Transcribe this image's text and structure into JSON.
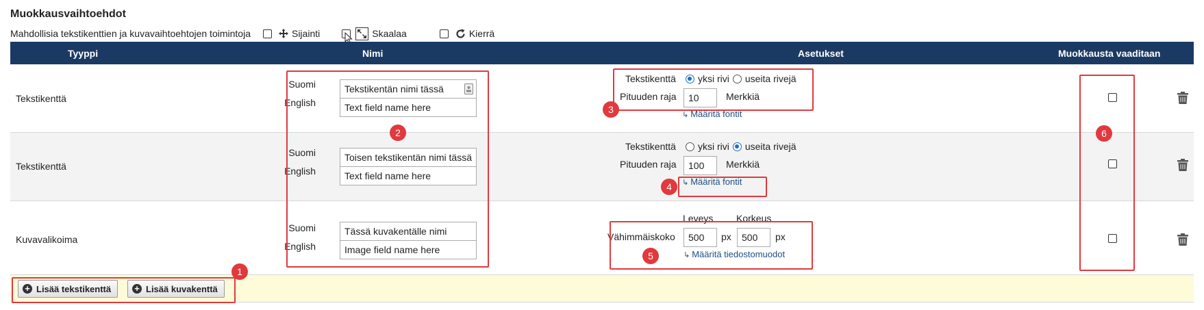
{
  "header": {
    "title": "Muokkausvaihtoehdot",
    "subtitle": "Mahdollisia tekstikenttien ja kuvavaihtoehtojen toimintoja",
    "options": [
      {
        "label": "Sijainti",
        "icon": "move-icon"
      },
      {
        "label": "Skaalaa",
        "icon": "scale-icon"
      },
      {
        "label": "Kierrä",
        "icon": "rotate-icon"
      }
    ]
  },
  "table": {
    "columns": [
      "Tyyppi",
      "Nimi",
      "Asetukset",
      "Muokkausta vaaditaan"
    ],
    "rows": [
      {
        "type": "Tekstikenttä",
        "lang1": "Suomi",
        "name1": "Tekstikentän nimi tässä",
        "lang2": "English",
        "name2": "Text field name here",
        "field_label": "Tekstikenttä",
        "radio_a": "yksi rivi",
        "radio_b": "useita rivejä",
        "length_label": "Pituuden raja",
        "length_value": "10",
        "unit": "Merkkiä",
        "fonts_link": "Määritä fontit"
      },
      {
        "type": "Tekstikenttä",
        "lang1": "Suomi",
        "name1": "Toisen tekstikentän nimi tässä",
        "lang2": "English",
        "name2": "Text field name here",
        "field_label": "Tekstikenttä",
        "radio_a": "yksi rivi",
        "radio_b": "useita rivejä",
        "length_label": "Pituuden raja",
        "length_value": "100",
        "unit": "Merkkiä",
        "fonts_link": "Määritä fontit"
      },
      {
        "type": "Kuvavalikoima",
        "lang1": "Suomi",
        "name1": "Tässä kuvakentälle nimi",
        "lang2": "English",
        "name2": "Image field name here",
        "width_label": "Leveys",
        "height_label": "Korkeus",
        "min_size_label": "Vähimmäiskoko",
        "width_value": "500",
        "height_value": "500",
        "px": "px",
        "formats_link": "Määritä tiedostomuodot"
      }
    ]
  },
  "footer": {
    "add_text_button": "Lisää tekstikenttä",
    "add_image_button": "Lisää kuvakenttä"
  },
  "badges": [
    "1",
    "2",
    "3",
    "4",
    "5",
    "6"
  ],
  "colors": {
    "header_bg": "#1b3a63",
    "annotation_red": "#e0393e",
    "footer_bg": "#fdfbd8",
    "link": "#1f4f82"
  }
}
